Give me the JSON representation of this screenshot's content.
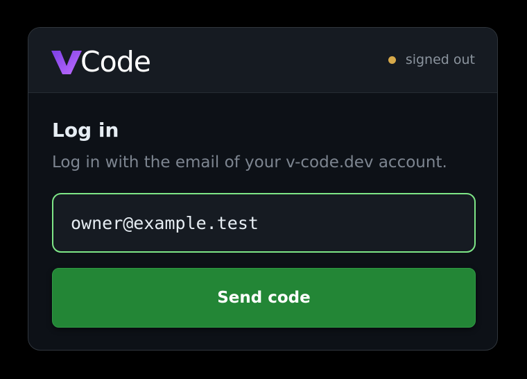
{
  "brand": {
    "logo_text": "Code",
    "logo_icon": "v-logo-icon",
    "accent_gradient": [
      "#7b3fe4",
      "#c06dff"
    ]
  },
  "status": {
    "label": "signed out",
    "dot_color": "#d7a94a"
  },
  "login": {
    "title": "Log in",
    "subtitle": "Log in with the email of your v-code.dev account.",
    "email_value": "owner@example.test",
    "send_button_label": "Send code"
  },
  "colors": {
    "input_border": "#7ee787",
    "button_bg": "#238636",
    "card_bg": "#0d1117"
  }
}
